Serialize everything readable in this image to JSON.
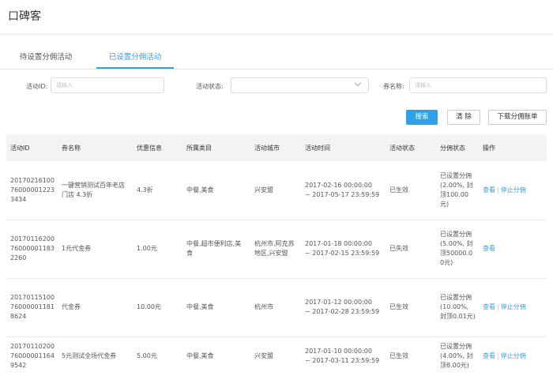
{
  "app": {
    "title": "口碑客"
  },
  "tabs": [
    {
      "label": "待设置分佣活动",
      "active": false
    },
    {
      "label": "已设置分佣活动",
      "active": true
    }
  ],
  "filters": {
    "activity_id": {
      "label": "活动ID:",
      "placeholder": "请输入",
      "value": ""
    },
    "activity_status": {
      "label": "活动状态:",
      "value": ""
    },
    "coupon_name": {
      "label": "券名称:",
      "placeholder": "请输入",
      "value": ""
    }
  },
  "buttons": {
    "search": "搜索",
    "clear": "清 除",
    "download": "下载分佣账单"
  },
  "table": {
    "headers": [
      "活动ID",
      "券名称",
      "优惠信息",
      "所属类目",
      "活动城市",
      "活动时间",
      "活动状态",
      "分佣状态",
      "操作"
    ],
    "rows": [
      {
        "id": "20170216100760000012233434",
        "name": "一键营销测试百年老店门店 4.3折",
        "discount": "4.3折",
        "category": "中餐,美食",
        "city": "兴安盟",
        "time_start": "2017-02-16 00:00:00",
        "time_end": "~ 2017-05-17 23:59:59",
        "status": "已生效",
        "commission": "已设置分佣(2.00%, 封顶100.00元)",
        "actions": [
          "查看",
          "停止分佣"
        ]
      },
      {
        "id": "20170116200760000011832260",
        "name": "1元代金券",
        "discount": "1.00元",
        "category": "中餐,超市便利店,美食",
        "city": "杭州市,阿克苏地区,兴安盟",
        "time_start": "2017-01-18 00:00:00",
        "time_end": "~ 2017-02-15 23:59:59",
        "status": "已失效",
        "commission": "已设置分佣(5.00%, 封顶50000.00元)",
        "actions": [
          "查看"
        ]
      },
      {
        "id": "20170115100760000011818624",
        "name": "代金券",
        "discount": "10.00元",
        "category": "中餐,美食",
        "city": "杭州市",
        "time_start": "2017-01-12 00:00:00",
        "time_end": "~ 2017-02-28 23:59:59",
        "status": "已生效",
        "commission": "已设置分佣(10.00%, 封顶0.01元)",
        "actions": [
          "查看",
          "停止分佣"
        ]
      },
      {
        "id": "20170110200760000011649542",
        "name": "5元测试全场代金券",
        "discount": "5.00元",
        "category": "中餐,美食",
        "city": "兴安盟",
        "time_start": "2017-01-10 00:00:00",
        "time_end": "~ 2017-03-11 23:59:59",
        "status": "已生效",
        "commission": "已设置分佣(4.00%, 封顶8.00元)",
        "actions": [
          "查看",
          "停止分佣"
        ]
      }
    ]
  }
}
